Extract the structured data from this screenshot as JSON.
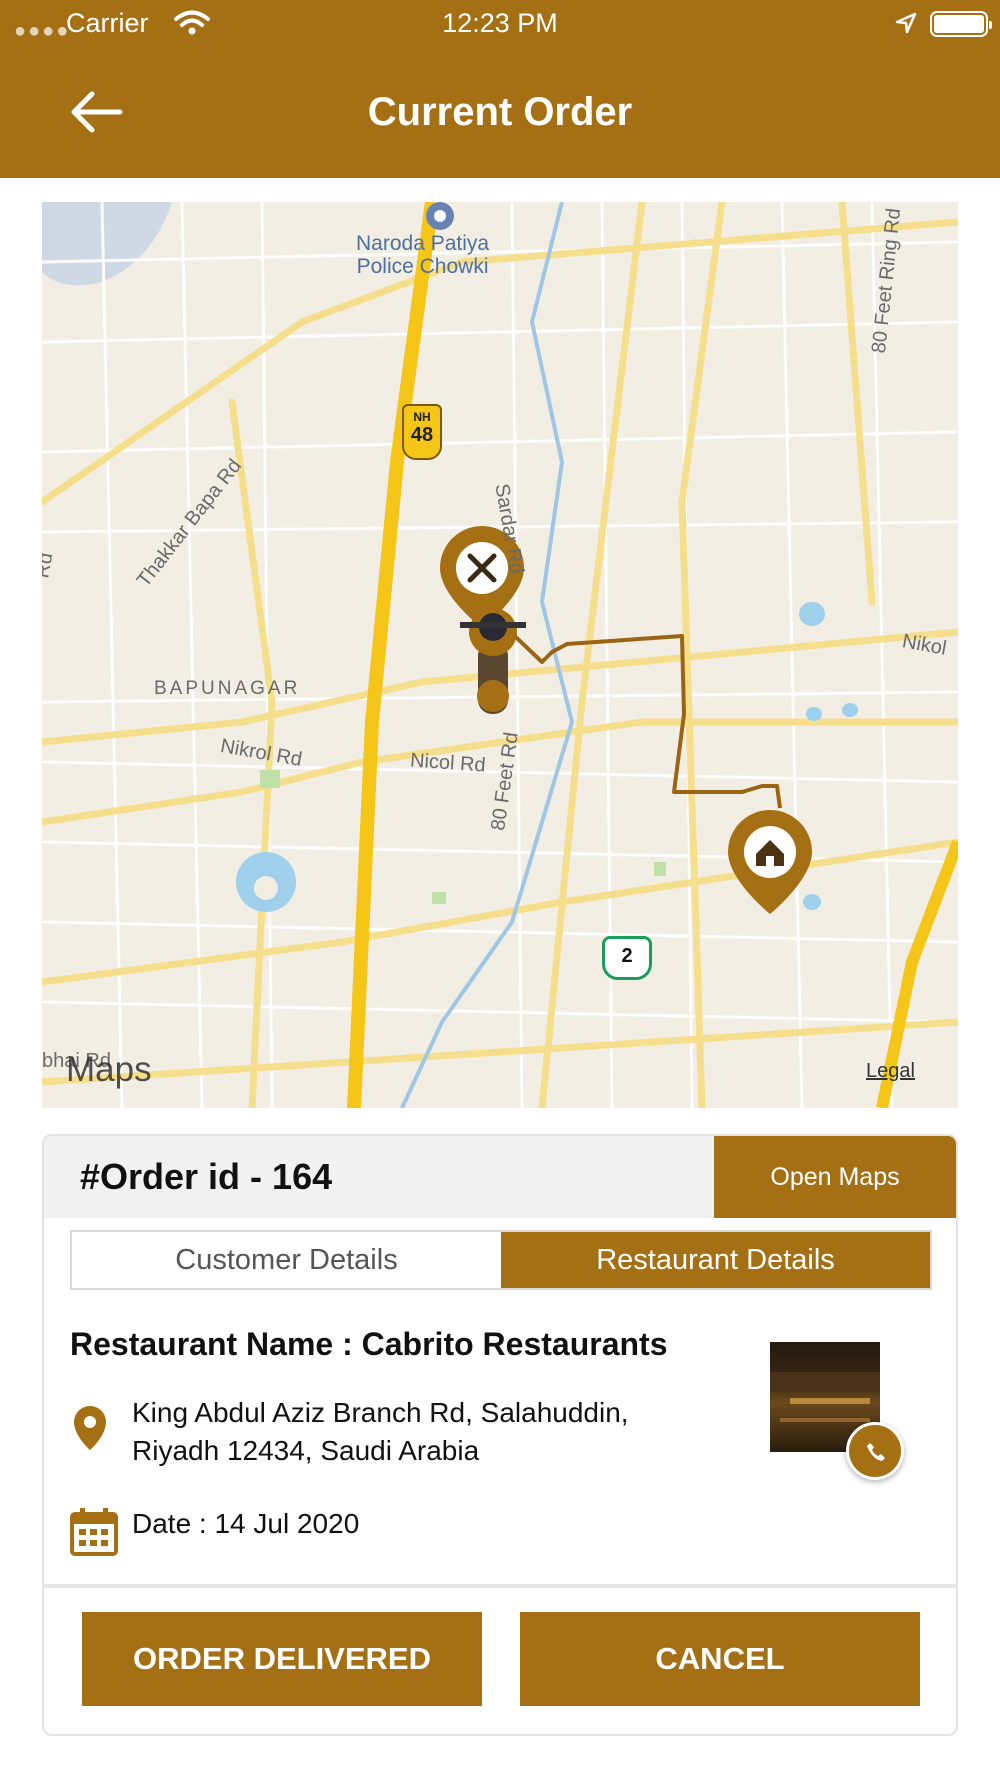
{
  "status_bar": {
    "carrier": "Carrier",
    "time": "12:23 PM"
  },
  "header": {
    "title": "Current Order"
  },
  "map": {
    "poi": {
      "line1": "Naroda Patiya",
      "line2": "Police Chowki"
    },
    "nh_shield": {
      "prefix": "NH",
      "number": "48"
    },
    "highway_shield": "2",
    "labels": {
      "bapunagar": "BAPUNAGAR",
      "thakkar": "Thakkar Bapa Rd",
      "sardar": "Sardar Rd",
      "nikrol": "Nikrol Rd",
      "nicol": "Nicol Rd",
      "feet80": "80 Feet Rd",
      "feet80ring": "80 Feet Ring Rd",
      "nikol": "Nikol",
      "rd_left": "Rd",
      "bottom_left": "bhai Rd"
    },
    "logo": "Maps",
    "legal": "Legal"
  },
  "order": {
    "id_label": "#Order id - 164",
    "open_maps": "Open Maps",
    "tabs": [
      {
        "label": "Customer Details",
        "active": false
      },
      {
        "label": "Restaurant Details",
        "active": true
      }
    ],
    "restaurant_name": "Restaurant Name :  Cabrito Restaurants",
    "address_line1": "King Abdul Aziz Branch Rd, Salahuddin,",
    "address_line2": "Riyadh 12434, Saudi Arabia",
    "date": "Date : 14 Jul 2020",
    "buttons": {
      "delivered": "ORDER DELIVERED",
      "cancel": "CANCEL"
    }
  },
  "colors": {
    "brand": "#a56f14",
    "route": "#9a6414"
  }
}
